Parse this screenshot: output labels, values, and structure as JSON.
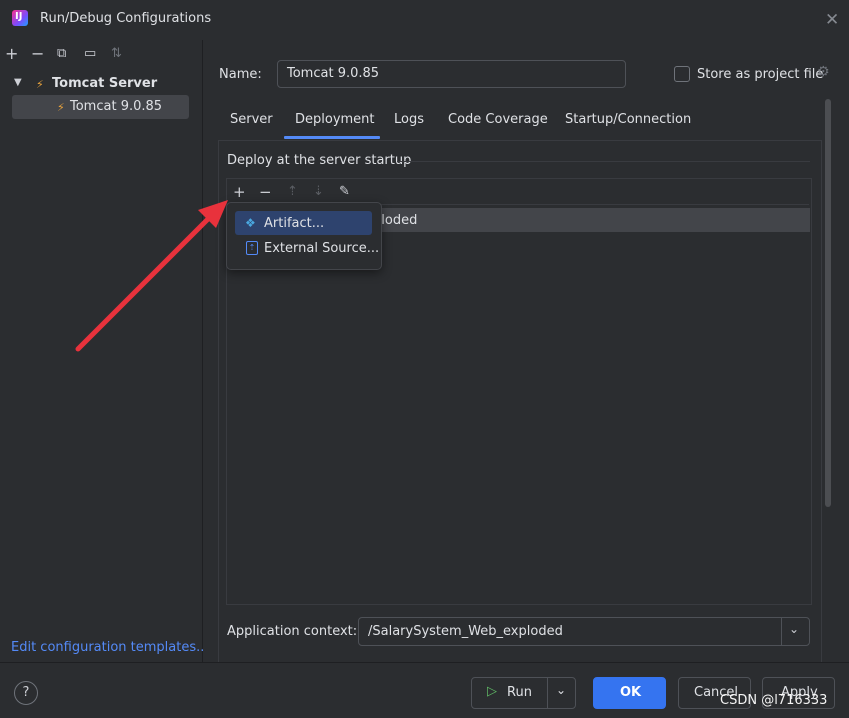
{
  "window": {
    "title": "Run/Debug Configurations",
    "app_icon_text": "IJ"
  },
  "sidebar": {
    "toolbar": [
      "add-icon",
      "remove-icon",
      "copy-icon",
      "folder-icon",
      "sort-icon"
    ],
    "tree": {
      "group_label": "Tomcat Server",
      "child_label": "Tomcat 9.0.85"
    },
    "edit_templates_link": "Edit configuration templates..."
  },
  "form": {
    "name_label": "Name:",
    "name_value": "Tomcat 9.0.85",
    "store_label": "Store as project file",
    "store_checked": false
  },
  "tabs": [
    {
      "label": "Server",
      "active": false
    },
    {
      "label": "Deployment",
      "active": true
    },
    {
      "label": "Logs",
      "active": false
    },
    {
      "label": "Code Coverage",
      "active": false
    },
    {
      "label": "Startup/Connection",
      "active": false
    }
  ],
  "deployment": {
    "section_label": "Deploy at the server startup",
    "list_rows": [
      {
        "text": "ploded"
      }
    ],
    "popup_items": [
      {
        "label": "Artifact...",
        "icon": "artifact-icon",
        "selected": true
      },
      {
        "label": "External Source...",
        "icon": "external-source-icon",
        "selected": false
      }
    ],
    "context_label": "Application context:",
    "context_value": "/SalarySystem_Web_exploded"
  },
  "footer": {
    "help": "?",
    "run_label": "Run",
    "ok_label": "OK",
    "cancel_label": "Cancel",
    "apply_label": "Apply"
  },
  "watermark": "CSDN @l716333",
  "colors": {
    "background": "#2b2d30",
    "accent": "#3574f0",
    "link": "#548af7",
    "annotation_arrow": "#e8323c"
  }
}
